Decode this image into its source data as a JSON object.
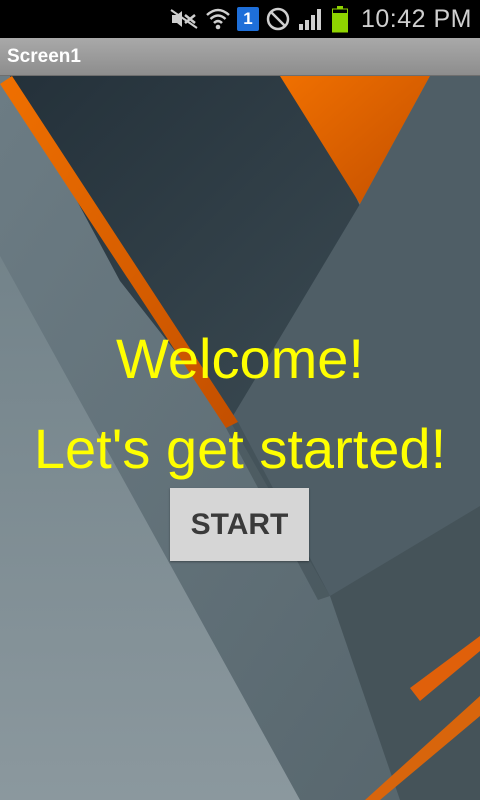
{
  "status_bar": {
    "time": "10:42 PM",
    "sim_label": "1",
    "icons": [
      "mute-icon",
      "wifi-icon",
      "sim-icon",
      "blocked-icon",
      "signal-icon",
      "battery-icon"
    ]
  },
  "title_bar": {
    "title": "Screen1"
  },
  "main": {
    "welcome_text": "Welcome!",
    "subtitle_text": "Let's get started!",
    "start_label": "START"
  },
  "colors": {
    "text_accent": "#ffff00",
    "background_dark": "#2c3a40",
    "background_gray": "#5e6e76",
    "accent_orange": "#ef6c00",
    "button_bg": "#d6d6d6"
  }
}
